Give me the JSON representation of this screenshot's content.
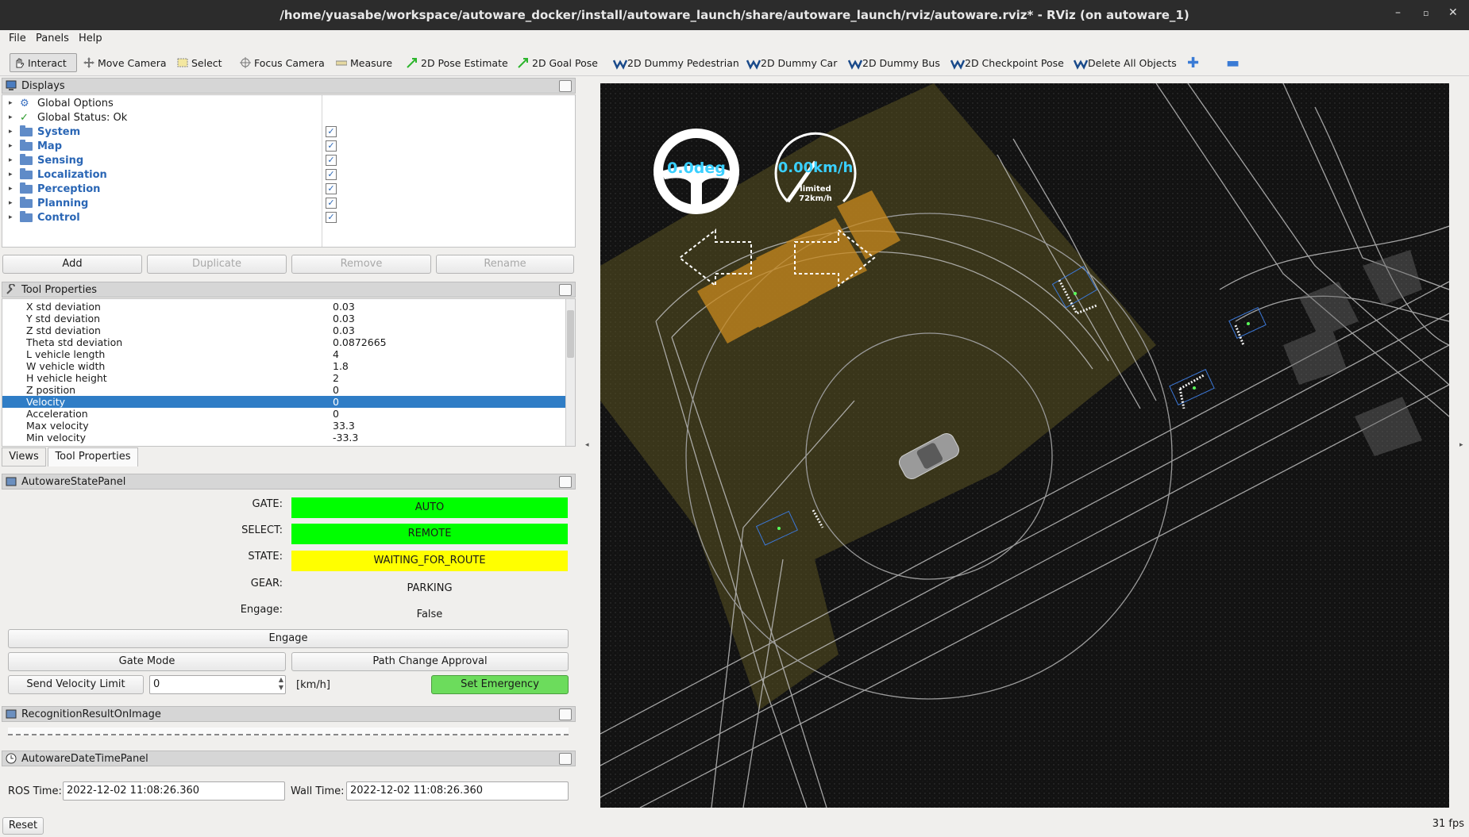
{
  "window": {
    "title": "/home/yuasabe/workspace/autoware_docker/install/autoware_launch/share/autoware_launch/rviz/autoware.rviz* - RViz (on autoware_1)"
  },
  "menu": [
    "File",
    "Panels",
    "Help"
  ],
  "toolbar": {
    "items": [
      {
        "label": "Interact",
        "icon": "hand-pointer-icon"
      },
      {
        "label": "Move Camera",
        "icon": "move-arrows-icon"
      },
      {
        "label": "Select",
        "icon": "select-box-icon"
      },
      {
        "label": "Focus Camera",
        "icon": "crosshair-icon"
      },
      {
        "label": "Measure",
        "icon": "ruler-icon"
      },
      {
        "label": "2D Pose Estimate",
        "icon": "green-arrow-icon"
      },
      {
        "label": "2D Goal Pose",
        "icon": "green-arrow-icon"
      },
      {
        "label": "2D Dummy Pedestrian",
        "icon": "autoware-logo-icon"
      },
      {
        "label": "2D Dummy Car",
        "icon": "autoware-logo-icon"
      },
      {
        "label": "2D Dummy Bus",
        "icon": "autoware-logo-icon"
      },
      {
        "label": "2D Checkpoint Pose",
        "icon": "autoware-logo-icon"
      },
      {
        "label": "Delete All Objects",
        "icon": "autoware-logo-icon"
      }
    ]
  },
  "displays": {
    "title": "Displays",
    "items": [
      {
        "label": "Global Options",
        "checked": null,
        "style": "plain"
      },
      {
        "label": "Global Status: Ok",
        "checked": null,
        "style": "plain"
      },
      {
        "label": "System",
        "checked": true,
        "style": "folder"
      },
      {
        "label": "Map",
        "checked": true,
        "style": "folder"
      },
      {
        "label": "Sensing",
        "checked": true,
        "style": "folder"
      },
      {
        "label": "Localization",
        "checked": true,
        "style": "folder"
      },
      {
        "label": "Perception",
        "checked": true,
        "style": "folder"
      },
      {
        "label": "Planning",
        "checked": true,
        "style": "folder"
      },
      {
        "label": "Control",
        "checked": true,
        "style": "folder"
      }
    ],
    "buttons": {
      "add": "Add",
      "duplicate": "Duplicate",
      "remove": "Remove",
      "rename": "Rename"
    }
  },
  "tool_properties": {
    "title": "Tool Properties",
    "rows": [
      {
        "name": "X std deviation",
        "value": "0.03"
      },
      {
        "name": "Y std deviation",
        "value": "0.03"
      },
      {
        "name": "Z std deviation",
        "value": "0.03"
      },
      {
        "name": "Theta std deviation",
        "value": "0.0872665"
      },
      {
        "name": "L vehicle length",
        "value": "4"
      },
      {
        "name": "W vehicle width",
        "value": "1.8"
      },
      {
        "name": "H vehicle height",
        "value": "2"
      },
      {
        "name": "Z position",
        "value": "0"
      },
      {
        "name": "Velocity",
        "value": "0"
      },
      {
        "name": "Acceleration",
        "value": "0"
      },
      {
        "name": "Max velocity",
        "value": "33.3"
      },
      {
        "name": "Min velocity",
        "value": "-33.3"
      }
    ],
    "tabs": [
      "Views",
      "Tool Properties"
    ]
  },
  "state_panel": {
    "title": "AutowareStatePanel",
    "gate_label": "GATE:",
    "gate_value": "AUTO",
    "select_label": "SELECT:",
    "select_value": "REMOTE",
    "state_label": "STATE:",
    "state_value": "WAITING_FOR_ROUTE",
    "gear_label": "GEAR:",
    "gear_value": "PARKING",
    "engage_label": "Engage:",
    "engage_value": "False",
    "engage_button": "Engage",
    "gate_mode_button": "Gate Mode",
    "path_change_button": "Path Change Approval",
    "send_velocity_button": "Send Velocity Limit",
    "velocity_value": "0",
    "velocity_unit": "[km/h]",
    "emergency_button": "Set Emergency",
    "colors": {
      "green": "#00ff00",
      "yellow": "#ffff00",
      "emergency": "#6cdc5c"
    }
  },
  "recognition_panel": {
    "title": "RecognitionResultOnImage"
  },
  "datetime_panel": {
    "title": "AutowareDateTimePanel",
    "ros_label": "ROS Time:",
    "ros_value": "2022-12-02 11:08:26.360",
    "wall_label": "Wall Time:",
    "wall_value": "2022-12-02 11:08:26.360"
  },
  "reset_button": "Reset",
  "fps": "31 fps",
  "viewport": {
    "steering_value": "0.0deg",
    "speed_value": "0.00km/h",
    "limit_label": "limited",
    "limit_value": "72km/h"
  }
}
